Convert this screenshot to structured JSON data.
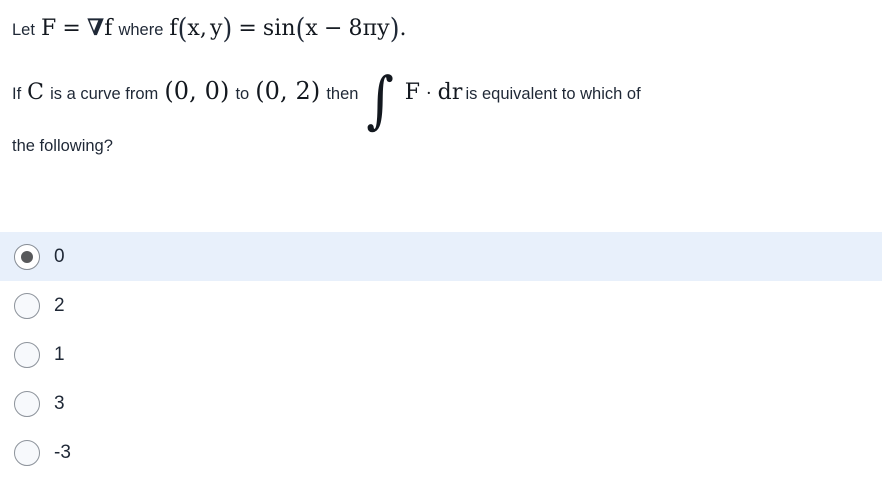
{
  "question": {
    "line1": {
      "lead": "Let",
      "math_F": "F",
      "eq": "=",
      "nabla": "∇",
      "f": "f",
      "where": "where",
      "f_of": "f",
      "paren_open": "(",
      "x": "x",
      "comma": ",",
      "y": "y",
      "paren_close": ")",
      "eq2": "=",
      "sin": "sin",
      "p_open": "(",
      "x2": "x",
      "minus": "−",
      "eight": "8",
      "pi": "π",
      "y2": "y",
      "p_close": ")",
      "period": "."
    },
    "line2": {
      "if": "If",
      "C": "C",
      "is_a_curve_from": "is a curve from",
      "point_a": "(0, 0)",
      "to": "to",
      "point_b": "(0, 2)",
      "then": "then",
      "integral": "∫",
      "F": "F",
      "dot": "·",
      "d": "d",
      "r": "r",
      "tail": "is equivalent to which of"
    },
    "line3": {
      "text": "the following?"
    }
  },
  "options": {
    "selected_index": 0,
    "items": [
      {
        "label": "0",
        "selected": true
      },
      {
        "label": "2",
        "selected": false
      },
      {
        "label": "1",
        "selected": false
      },
      {
        "label": "3",
        "selected": false
      },
      {
        "label": "-3",
        "selected": false
      }
    ]
  },
  "colors": {
    "selected_row_background": "#e8f0fb",
    "text": "#1f2836",
    "radio_border": "#8d939b",
    "radio_dot": "#58595b",
    "page_background": "#ffffff"
  }
}
